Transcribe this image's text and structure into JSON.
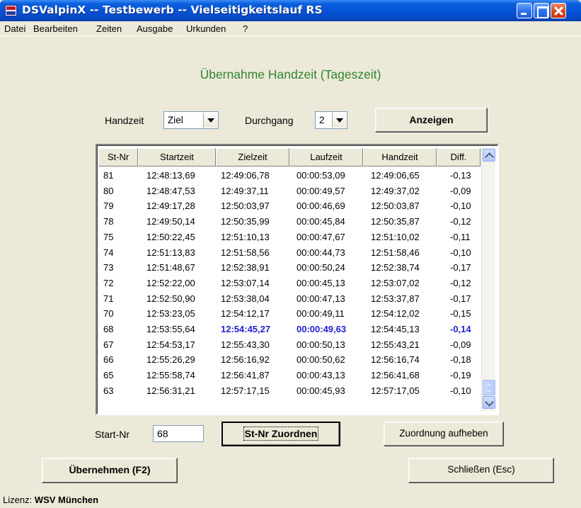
{
  "window": {
    "title": "DSValpinX -- Testbewerb -- Vielseitigkeitslauf RS"
  },
  "menu": [
    "Datei",
    "Bearbeiten",
    "Zeiten",
    "Ausgabe",
    "Urkunden",
    "?"
  ],
  "heading": "Übernahme Handzeit (Tageszeit)",
  "controls": {
    "handzeit_label": "Handzeit",
    "handzeit_value": "Ziel",
    "durchgang_label": "Durchgang",
    "durchgang_value": "2",
    "anzeigen_button": "Anzeigen"
  },
  "table": {
    "headers": [
      "St-Nr",
      "Startzeit",
      "Zielzeit",
      "Laufzeit",
      "Handzeit",
      "Diff."
    ],
    "rows": [
      [
        "81",
        "12:48:13,69",
        "12:49:06,78",
        "00:00:53,09",
        "12:49:06,65",
        "-0,13"
      ],
      [
        "80",
        "12:48:47,53",
        "12:49:37,11",
        "00:00:49,57",
        "12:49:37,02",
        "-0,09"
      ],
      [
        "79",
        "12:49:17,28",
        "12:50:03,97",
        "00:00:46,69",
        "12:50:03,87",
        "-0,10"
      ],
      [
        "78",
        "12:49:50,14",
        "12:50:35,99",
        "00:00:45,84",
        "12:50:35,87",
        "-0,12"
      ],
      [
        "75",
        "12:50:22,45",
        "12:51:10,13",
        "00:00:47,67",
        "12:51:10,02",
        "-0,11"
      ],
      [
        "74",
        "12:51:13,83",
        "12:51:58,56",
        "00:00:44,73",
        "12:51:58,46",
        "-0,10"
      ],
      [
        "73",
        "12:51:48,67",
        "12:52:38,91",
        "00:00:50,24",
        "12:52:38,74",
        "-0,17"
      ],
      [
        "72",
        "12:52:22,00",
        "12:53:07,14",
        "00:00:45,13",
        "12:53:07,02",
        "-0,12"
      ],
      [
        "71",
        "12:52:50,90",
        "12:53:38,04",
        "00:00:47,13",
        "12:53:37,87",
        "-0,17"
      ],
      [
        "70",
        "12:53:23,05",
        "12:54:12,17",
        "00:00:49,11",
        "12:54:12,02",
        "-0,15"
      ],
      [
        "68",
        "12:53:55,64",
        "12:54:45,27",
        "00:00:49,63",
        "12:54:45,13",
        "-0,14"
      ],
      [
        "67",
        "12:54:53,17",
        "12:55:43,30",
        "00:00:50,13",
        "12:55:43,21",
        "-0,09"
      ],
      [
        "66",
        "12:55:26,29",
        "12:56:16,92",
        "00:00:50,62",
        "12:56:16,74",
        "-0,18"
      ],
      [
        "65",
        "12:55:58,74",
        "12:56:41,87",
        "00:00:43,13",
        "12:56:41,68",
        "-0,19"
      ],
      [
        "63",
        "12:56:31,21",
        "12:57:17,15",
        "00:00:45,93",
        "12:57:17,05",
        "-0,10"
      ]
    ],
    "selected_start_nr": "68",
    "highlight_color": "#1f1fd6"
  },
  "assign": {
    "start_nr_label": "Start-Nr",
    "start_nr_value": "68",
    "assign_button": "St-Nr Zuordnen",
    "remove_button": "Zuordnung aufheben"
  },
  "footer": {
    "accept_button": "Übernehmen (F2)",
    "close_button": "Schließen (Esc)",
    "license_label": "Lizenz:",
    "license_value": "WSV München"
  },
  "colors": {
    "heading": "#338531",
    "titlebar": "#0553d6",
    "window_bg": "#ece9d8"
  }
}
